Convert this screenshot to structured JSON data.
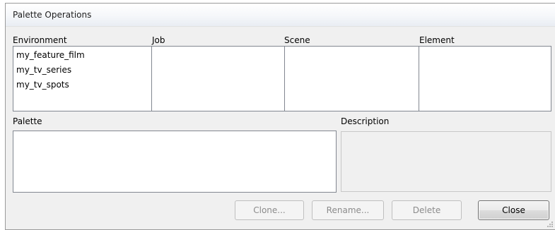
{
  "window": {
    "title": "Palette Operations"
  },
  "lists": {
    "environment": {
      "label": "Environment",
      "items": [
        "my_feature_film",
        "my_tv_series",
        "my_tv_spots"
      ]
    },
    "job": {
      "label": "Job",
      "items": []
    },
    "scene": {
      "label": "Scene",
      "items": []
    },
    "element": {
      "label": "Element",
      "items": []
    }
  },
  "palette": {
    "label": "Palette",
    "items": []
  },
  "description": {
    "label": "Description",
    "value": ""
  },
  "buttons": {
    "clone": "Clone...",
    "rename": "Rename...",
    "delete": "Delete",
    "close": "Close"
  },
  "icons": {
    "resize_grip": "resize-grip-icon"
  },
  "colors": {
    "list_border": "#828790",
    "disabled_text": "#8b8b8b",
    "window_bg": "#f0f0f0"
  }
}
